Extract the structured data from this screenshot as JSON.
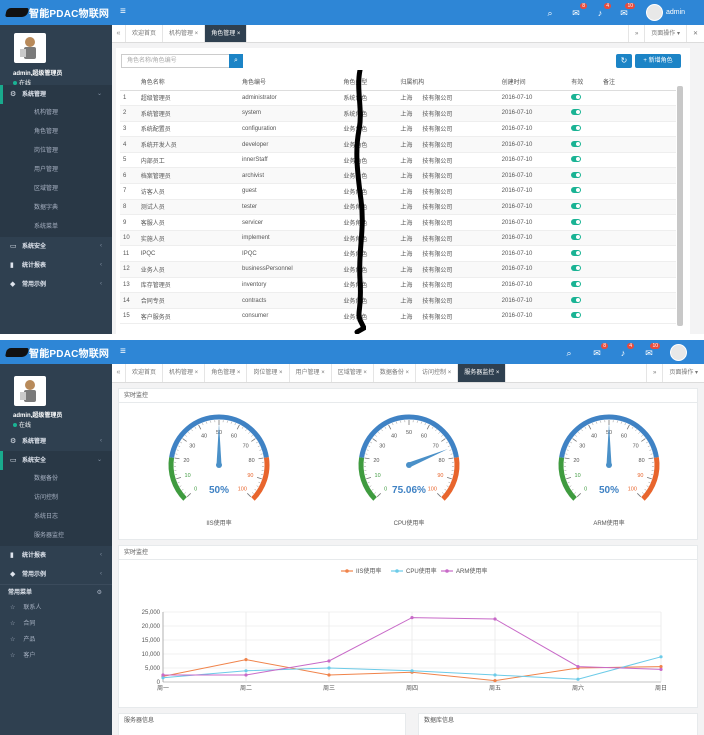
{
  "app": {
    "title": "智能PDAC物联网",
    "admin_name": "admin",
    "profile_name": "admin,超级管理员",
    "status": "在线"
  },
  "colors": {
    "topbar": "#2e86d6",
    "sidebar": "#2f4050",
    "accent": "#1ab394",
    "primary": "#1c84c6"
  },
  "shot1": {
    "badges": [
      "8",
      "4",
      "10"
    ],
    "tabs": [
      {
        "label": "欢迎首页"
      },
      {
        "label": "机构管理 ×"
      },
      {
        "label": "角色管理 ×",
        "active": true
      }
    ],
    "tab_ops": "页面操作 ▾",
    "sidebar": [
      {
        "label": "系统管理",
        "icon": "gear-icon",
        "glyph": "⚙",
        "open": true,
        "children": [
          "机构管理",
          "角色管理",
          "岗位管理",
          "用户管理",
          "区域管理",
          "数据字典",
          "系统菜单"
        ]
      },
      {
        "label": "系统安全",
        "icon": "monitor-icon",
        "glyph": "▭"
      },
      {
        "label": "统计报表",
        "icon": "bar-chart-icon",
        "glyph": "▮"
      },
      {
        "label": "常用示例",
        "icon": "tag-icon",
        "glyph": "◆"
      }
    ],
    "search_placeholder": "角色名称/角色编号",
    "add_button": "+ 新增角色",
    "columns": [
      "",
      "角色名称",
      "角色编号",
      "角色类型",
      "归属机构",
      "创建时间",
      "有效",
      "备注"
    ],
    "rows": [
      [
        "1",
        "超级管理员",
        "administrator",
        "系统角色",
        "上海",
        "技有限公司",
        "2016-07-10"
      ],
      [
        "2",
        "系统管理员",
        "system",
        "系统角色",
        "上海",
        "技有限公司",
        "2016-07-10"
      ],
      [
        "3",
        "系统配置员",
        "configuration",
        "业务角色",
        "上海",
        "技有限公司",
        "2016-07-10"
      ],
      [
        "4",
        "系统开发人员",
        "developer",
        "业务角色",
        "上海",
        "技有限公司",
        "2016-07-10"
      ],
      [
        "5",
        "内部员工",
        "innerStaff",
        "业务角色",
        "上海",
        "技有限公司",
        "2016-07-10"
      ],
      [
        "6",
        "档案管理员",
        "archivist",
        "业务角色",
        "上海",
        "技有限公司",
        "2016-07-10"
      ],
      [
        "7",
        "访客人员",
        "guest",
        "业务角色",
        "上海",
        "技有限公司",
        "2016-07-10"
      ],
      [
        "8",
        "测试人员",
        "tester",
        "业务角色",
        "上海",
        "技有限公司",
        "2016-07-10"
      ],
      [
        "9",
        "客服人员",
        "servicer",
        "业务角色",
        "上海",
        "技有限公司",
        "2016-07-10"
      ],
      [
        "10",
        "实施人员",
        "implement",
        "业务角色",
        "上海",
        "技有限公司",
        "2016-07-10"
      ],
      [
        "11",
        "IPQC",
        "IPQC",
        "业务角色",
        "上海",
        "技有限公司",
        "2016-07-10"
      ],
      [
        "12",
        "业务人员",
        "businessPersonnel",
        "业务角色",
        "上海",
        "技有限公司",
        "2016-07-10"
      ],
      [
        "13",
        "库存管理员",
        "inventory",
        "业务角色",
        "上海",
        "技有限公司",
        "2016-07-10"
      ],
      [
        "14",
        "合同专员",
        "contracts",
        "业务角色",
        "上海",
        "技有限公司",
        "2016-07-10"
      ],
      [
        "15",
        "客户服务员",
        "consumer",
        "业务角色",
        "上海",
        "技有限公司",
        "2016-07-10"
      ]
    ]
  },
  "shot2": {
    "badges": [
      "8",
      "4",
      "10"
    ],
    "tabs": [
      {
        "label": "欢迎首页"
      },
      {
        "label": "机构管理 ×"
      },
      {
        "label": "角色管理 ×"
      },
      {
        "label": "岗位管理 ×"
      },
      {
        "label": "用户管理 ×"
      },
      {
        "label": "区域管理 ×"
      },
      {
        "label": "数据备份 ×"
      },
      {
        "label": "访问控制 ×"
      },
      {
        "label": "服务器监控 ×",
        "active": true
      }
    ],
    "tab_ops": "页面操作 ▾",
    "sidebar": [
      {
        "label": "系统管理",
        "icon": "gear-icon",
        "glyph": "⚙"
      },
      {
        "label": "系统安全",
        "icon": "monitor-icon",
        "glyph": "▭",
        "open": true,
        "children": [
          "数据备份",
          "访问控制",
          "系统日志",
          "服务器监控"
        ]
      },
      {
        "label": "统计报表",
        "icon": "bar-chart-icon",
        "glyph": "▮"
      },
      {
        "label": "常用示例",
        "icon": "tag-icon",
        "glyph": "◆"
      }
    ],
    "common_menu_title": "常用菜单",
    "common_menu": [
      "联系人",
      "合同",
      "产品",
      "客户"
    ],
    "realtime_title": "实时监控",
    "realtime_title_2": "实时监控",
    "server_info_title": "服务器信息",
    "db_info_title": "数据库信息",
    "gauges": [
      {
        "label": "IIS使用率",
        "value": 50,
        "display": "50%",
        "needle_color": "#4a90c8"
      },
      {
        "label": "CPU使用率",
        "value": 75.06,
        "display": "75.06%",
        "needle_color": "#4a90c8"
      },
      {
        "label": "ARM使用率",
        "value": 50,
        "display": "50%",
        "needle_color": "#4a90c8"
      }
    ],
    "gauge_ticks": [
      "0",
      "10",
      "20",
      "30",
      "40",
      "50",
      "60",
      "70",
      "80",
      "90",
      "100"
    ]
  },
  "chart_data": {
    "type": "line",
    "categories": [
      "周一",
      "周二",
      "周三",
      "周四",
      "周五",
      "周六",
      "周日"
    ],
    "series": [
      {
        "name": "IIS使用率",
        "color": "#f0834a",
        "values": [
          2000,
          8000,
          2500,
          3500,
          500,
          5000,
          5500
        ]
      },
      {
        "name": "CPU使用率",
        "color": "#6ccbe8",
        "values": [
          1500,
          4000,
          5000,
          4000,
          2500,
          1000,
          9000
        ]
      },
      {
        "name": "ARM使用率",
        "color": "#c86ac8",
        "values": [
          2500,
          2500,
          7500,
          23000,
          22500,
          5500,
          4500
        ]
      }
    ],
    "yticks": [
      "0",
      "5,000",
      "10,000",
      "15,000",
      "20,000",
      "25,000"
    ],
    "ylim": [
      0,
      25000
    ],
    "legend": "top-center",
    "grid": true
  }
}
